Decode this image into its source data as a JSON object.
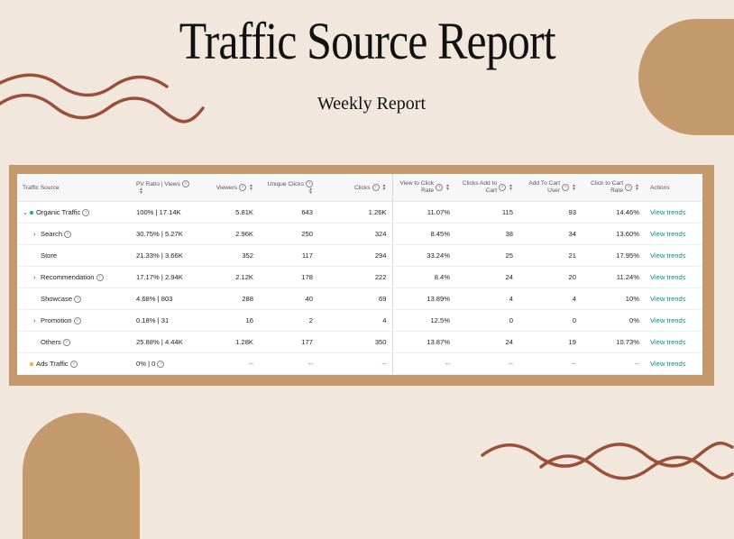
{
  "header": {
    "title": "Traffic Source Report",
    "subtitle": "Weekly Report"
  },
  "colors": {
    "background": "#f1e7dc",
    "accent": "#c49a6c",
    "wave": "#9b4f38",
    "link": "#0f8a8a"
  },
  "table": {
    "headers": {
      "source": "Traffic Source",
      "pv": "PV Ratio | Views",
      "viewers": "Viewers",
      "unique_clicks": "Unique Clicks",
      "clicks": "Clicks",
      "vtc_1": "View to Click",
      "vtc_2": "Rate",
      "cac_1": "Clicks Add to",
      "cac_2": "Cart",
      "atc_1": "Add To Cart",
      "atc_2": "User",
      "ctc_1": "Click to Cart",
      "ctc_2": "Rate",
      "actions": "Actions"
    },
    "help_glyph": "?",
    "rows": [
      {
        "source": "Organic Traffic",
        "pv": "100% | 17.14K",
        "viewers": "5.81K",
        "unique_clicks": "643",
        "clicks": "1.26K",
        "vtc": "11.07%",
        "cac": "115",
        "atc": "93",
        "ctc": "14.46%",
        "action": "View trends"
      },
      {
        "source": "Search",
        "pv": "30.75% | 5.27K",
        "viewers": "2.96K",
        "unique_clicks": "250",
        "clicks": "324",
        "vtc": "8.45%",
        "cac": "38",
        "atc": "34",
        "ctc": "13.60%",
        "action": "View trends"
      },
      {
        "source": "Store",
        "pv": "21.33% | 3.66K",
        "viewers": "352",
        "unique_clicks": "117",
        "clicks": "294",
        "vtc": "33.24%",
        "cac": "25",
        "atc": "21",
        "ctc": "17.95%",
        "action": "View trends"
      },
      {
        "source": "Recommendation",
        "pv": "17.17% | 2.94K",
        "viewers": "2.12K",
        "unique_clicks": "178",
        "clicks": "222",
        "vtc": "8.4%",
        "cac": "24",
        "atc": "20",
        "ctc": "11.24%",
        "action": "View trends"
      },
      {
        "source": "Showcase",
        "pv": "4.68% | 803",
        "viewers": "288",
        "unique_clicks": "40",
        "clicks": "69",
        "vtc": "13.89%",
        "cac": "4",
        "atc": "4",
        "ctc": "10%",
        "action": "View trends"
      },
      {
        "source": "Promotion",
        "pv": "0.18% | 31",
        "viewers": "16",
        "unique_clicks": "2",
        "clicks": "4",
        "vtc": "12.5%",
        "cac": "0",
        "atc": "0",
        "ctc": "0%",
        "action": "View trends"
      },
      {
        "source": "Others",
        "pv": "25.88% | 4.44K",
        "viewers": "1.28K",
        "unique_clicks": "177",
        "clicks": "350",
        "vtc": "13.87%",
        "cac": "24",
        "atc": "19",
        "ctc": "10.73%",
        "action": "View trends"
      },
      {
        "source": "Ads Traffic",
        "pv": "0% | 0",
        "viewers": "--",
        "unique_clicks": "--",
        "clicks": "--",
        "vtc": "--",
        "cac": "--",
        "atc": "--",
        "ctc": "--",
        "action": "View trends"
      }
    ]
  }
}
